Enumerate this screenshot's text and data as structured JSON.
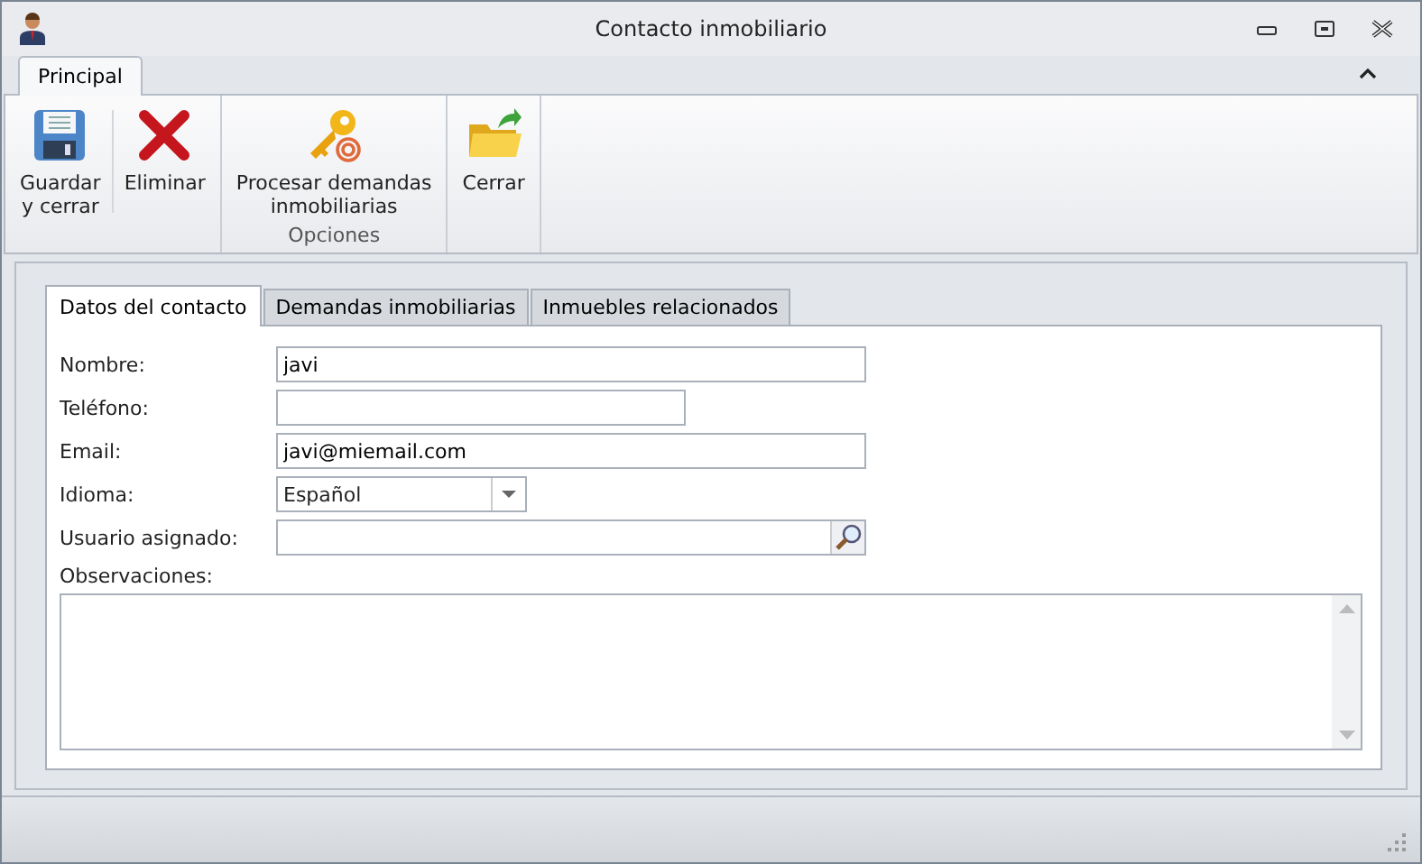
{
  "window": {
    "title": "Contacto inmobiliario"
  },
  "ribbon": {
    "tabs": [
      {
        "label": "Principal",
        "selected": true
      }
    ],
    "groups": [
      {
        "buttons": [
          {
            "label": "Guardar\ny cerrar",
            "kind": "save"
          },
          {
            "label": "Eliminar",
            "kind": "delete"
          }
        ]
      },
      {
        "label": "Opciones",
        "buttons": [
          {
            "label": "Procesar demandas\ninmobiliarias",
            "kind": "key"
          }
        ]
      },
      {
        "buttons": [
          {
            "label": "Cerrar",
            "kind": "folder"
          }
        ]
      }
    ]
  },
  "tabs": [
    {
      "label": "Datos del contacto",
      "selected": true
    },
    {
      "label": "Demandas inmobiliarias",
      "selected": false
    },
    {
      "label": "Inmuebles relacionados",
      "selected": false
    }
  ],
  "fields": [
    {
      "label": "Nombre:",
      "kind": "text",
      "value": "javi"
    },
    {
      "label": "Teléfono:",
      "kind": "phone"
    },
    {
      "label": "Email:",
      "kind": "text",
      "value": "javi@miemail.com"
    },
    {
      "label": "Idioma:",
      "kind": "combo",
      "value": "Español"
    },
    {
      "label": "Usuario asignado:",
      "kind": "lookup"
    },
    {
      "label": "Observaciones:",
      "kind": "memo"
    }
  ]
}
